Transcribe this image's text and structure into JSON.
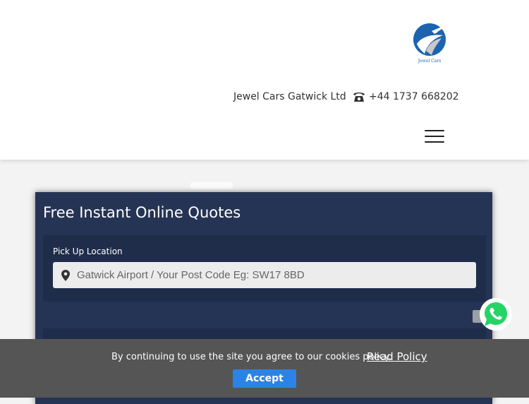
{
  "header": {
    "logo_text": "Jewel Cars",
    "company_name": "Jewel Cars Gatwick Ltd",
    "phone": "+44 1737 668202",
    "icons": {
      "phone": "telephone-icon",
      "menu": "hamburger-menu-icon"
    }
  },
  "quote_form": {
    "title": "Free Instant Online Quotes",
    "pickup_label": "Pick Up Location",
    "pickup_placeholder": "Gatwick Airport / Your Post Code Eg: SW17 8BD",
    "pickup_value": "",
    "icons": {
      "pickup": "map-pin-icon"
    }
  },
  "cookie_notice": {
    "text": "By continuing to use the site you agree to our cookies policy.",
    "link_label": "Read Policy",
    "accept_label": "Accept"
  },
  "floating": {
    "whatsapp_icon": "whatsapp-icon"
  },
  "colors": {
    "header_bg": "#ffffff",
    "card_bg": "#253454",
    "panel_bg": "#1f2d4b",
    "cookie_bg": "#555555",
    "accept_button": "#2c83e6",
    "whatsapp_green": "#25d366",
    "logo_blue": "#1e63b0"
  }
}
